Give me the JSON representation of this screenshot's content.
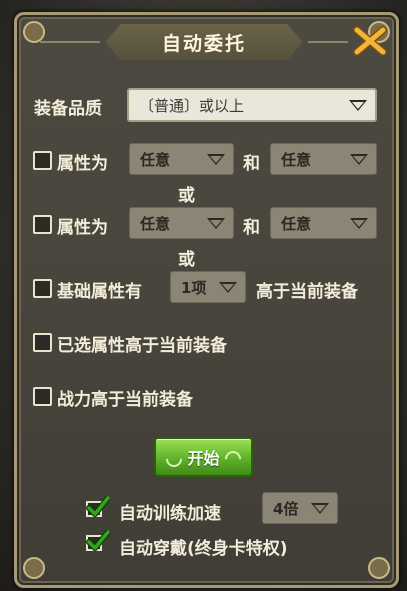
{
  "dialog": {
    "title": "自动委托",
    "quality": {
      "label": "装备品质",
      "value": "〔普通〕或以上"
    },
    "rows": [
      {
        "label": "属性为",
        "select1": "任意",
        "and": "和",
        "select2": "任意"
      },
      {
        "label": "属性为",
        "select1": "任意",
        "and": "和",
        "select2": "任意"
      }
    ],
    "or_label": "或",
    "base_attr": {
      "label": "基础属性有",
      "select": "1项",
      "suffix": "高于当前装备"
    },
    "selected_attr": {
      "label": "已选属性高于当前装备"
    },
    "power": {
      "label": "战力高于当前装备"
    },
    "start_label": "开始",
    "auto_train": {
      "label": "自动训练加速",
      "select": "4倍",
      "checked": true
    },
    "auto_equip": {
      "label": "自动穿戴(终身卡特权)",
      "checked": true
    }
  },
  "colors": {
    "check": "#2fa61c",
    "start": "#5fb12a"
  }
}
